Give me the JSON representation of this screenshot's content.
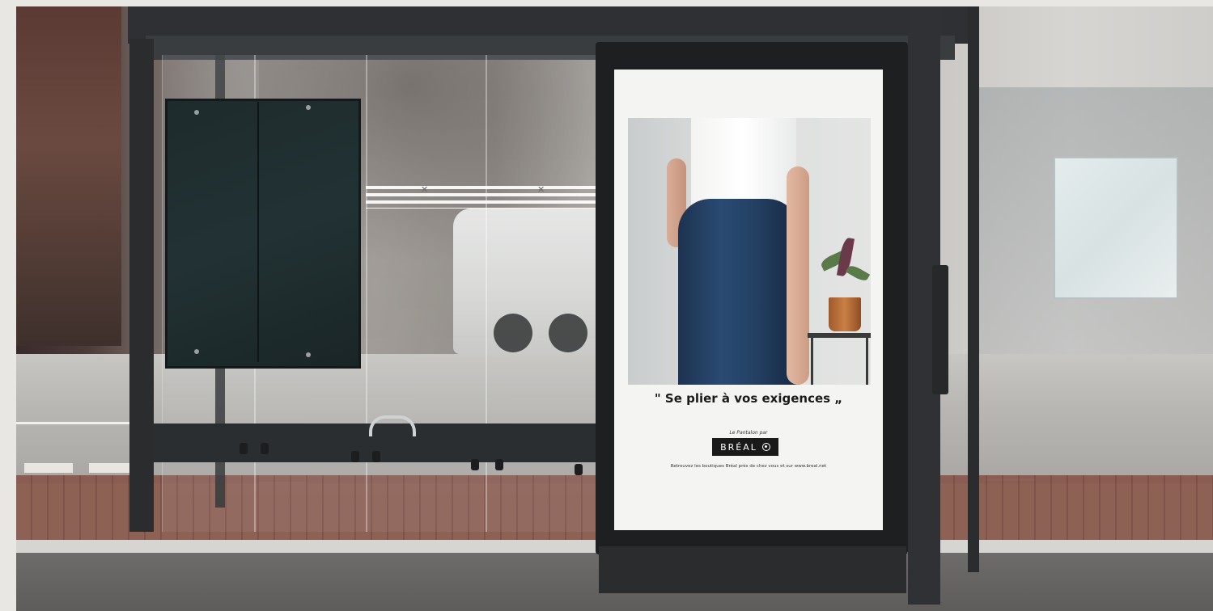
{
  "glass_band": {
    "marks": [
      "✕",
      "✕"
    ]
  },
  "poster": {
    "slogan": "\" Se plier à vos exigences „",
    "brand_tagline": "Le Pantalon par",
    "brand_name": "BRÉAL",
    "footer": "Retrouvez les boutiques Bréal près de chez vous et sur www.breal.net"
  },
  "colors": {
    "shelter_frame": "#2e3033",
    "poster_background": "#f4f4f3",
    "brand_box": "#1a1a1a",
    "jeans": "#2a4a72"
  },
  "icons": {
    "brand_logo": "circle-dot-icon"
  }
}
